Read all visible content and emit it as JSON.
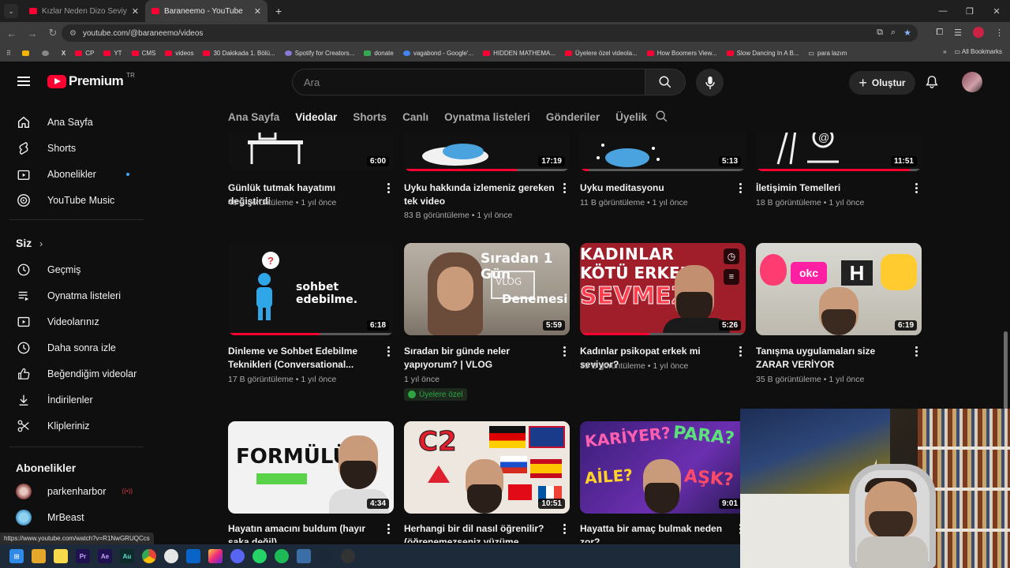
{
  "browser": {
    "tabs": [
      {
        "title": "Kızlar Neden Dizo Seviyor? - Yo",
        "active": false
      },
      {
        "title": "Baraneemo - YouTube",
        "active": true
      }
    ],
    "url": "youtube.com/@baraneemo/videos",
    "bookmarks": [
      "CP",
      "YT",
      "CMS",
      "videos",
      "30 Dakikada 1. Bölü...",
      "Spotify for Creators...",
      "donate",
      "vagabond - Google'...",
      "HIDDEN MATHEMA...",
      "Üyelere özel videola...",
      "How Boomers View...",
      "Slow Dancing In A B...",
      "para lazım"
    ],
    "all_bookmarks": "All Bookmarks",
    "status_url": "https://www.youtube.com/watch?v=R1NwGRUQCcs"
  },
  "masthead": {
    "logo_text": "Premium",
    "country": "TR",
    "search_placeholder": "Ara",
    "create_label": "Oluştur"
  },
  "sidebar": {
    "main": [
      {
        "label": "Ana Sayfa",
        "icon": "home-icon"
      },
      {
        "label": "Shorts",
        "icon": "shorts-icon"
      },
      {
        "label": "Abonelikler",
        "icon": "subscriptions-icon",
        "new": true
      },
      {
        "label": "YouTube Music",
        "icon": "music-icon"
      }
    ],
    "you_heading": "Siz",
    "you": [
      {
        "label": "Geçmiş",
        "icon": "history-icon"
      },
      {
        "label": "Oynatma listeleri",
        "icon": "playlists-icon"
      },
      {
        "label": "Videolarınız",
        "icon": "your-videos-icon"
      },
      {
        "label": "Daha sonra izle",
        "icon": "watch-later-icon"
      },
      {
        "label": "Beğendiğim videolar",
        "icon": "liked-icon"
      },
      {
        "label": "İndirilenler",
        "icon": "downloads-icon"
      },
      {
        "label": "Klipleriniz",
        "icon": "clips-icon"
      }
    ],
    "subs_heading": "Abonelikler",
    "subs": [
      {
        "label": "parkenharbor",
        "live": true
      },
      {
        "label": "MrBeast",
        "live": false
      }
    ]
  },
  "channel_tabs": [
    "Ana Sayfa",
    "Videolar",
    "Shorts",
    "Canlı",
    "Oynatma listeleri",
    "Gönderiler",
    "Üyelik"
  ],
  "active_tab": "Videolar",
  "videos": [
    {
      "title": "Günlük tutmak hayatımı değiştirdi",
      "views": "40 B görüntüleme",
      "age": "1 yıl önce",
      "duration": "6:00",
      "watched": 0
    },
    {
      "title": "Uyku hakkında izlemeniz gereken tek video",
      "views": "83 B görüntüleme",
      "age": "1 yıl önce",
      "duration": "17:19",
      "watched": 0.68
    },
    {
      "title": "Uyku meditasyonu",
      "views": "11 B görüntüleme",
      "age": "1 yıl önce",
      "duration": "5:13",
      "watched": 0.05
    },
    {
      "title": "İletişimin Temelleri",
      "views": "18 B görüntüleme",
      "age": "1 yıl önce",
      "duration": "11:51",
      "watched": 0.93
    },
    {
      "title": "Dinleme ve Sohbet Edebilme Teknikleri (Conversational...",
      "views": "17 B görüntüleme",
      "age": "1 yıl önce",
      "duration": "6:18",
      "watched": 0.55,
      "thumb_text": "sohbet edebilme."
    },
    {
      "title": "Sıradan bir günde neler yapıyorum? | VLOG",
      "views": "",
      "age": "1 yıl önce",
      "duration": "5:59",
      "watched": 0,
      "members": "Üyelere özel",
      "thumb_text": "Sıradan 1 Gün",
      "thumb_text2": "VLOG",
      "thumb_text3": "Denemesi"
    },
    {
      "title": "Kadınlar psikopat erkek mi seviyor?",
      "views": "15 B görüntüleme",
      "age": "1 yıl önce",
      "duration": "5:26",
      "watched": 0.42,
      "thumb_text": "KADINLAR",
      "thumb_text2": "KÖTÜ ERKEK",
      "thumb_text3": "SEVMEZ"
    },
    {
      "title": "Tanışma uygulamaları size ZARAR VERİYOR",
      "views": "35 B görüntüleme",
      "age": "1 yıl önce",
      "duration": "6:19",
      "watched": 0,
      "thumb_text": "okc"
    },
    {
      "title": "Hayatın amacını buldum (hayır şaka değil)",
      "views": "",
      "age": "",
      "duration": "4:34",
      "watched": 0,
      "thumb_text": "FORMÜLÜ"
    },
    {
      "title": "Herhangi bir dil nasıl öğrenilir? (öğrenemezseniz yüzüme tükürün)",
      "views": "",
      "age": "",
      "duration": "10:51",
      "watched": 0,
      "thumb_text": "C2"
    },
    {
      "title": "Hayatta bir amaç bulmak neden zor?",
      "views": "",
      "age": "",
      "duration": "9:01",
      "watched": 0,
      "thumb_text": "KARİYER?",
      "thumb_text2": "PARA?",
      "thumb_text3": "AİLE?",
      "thumb_text4": "AŞK?"
    }
  ],
  "taskbar": [
    "windows-icon",
    "explorer-icon",
    "sticky-icon",
    "Pr",
    "Ae",
    "Au",
    "chrome-icon",
    "app-icon",
    "outlook-icon",
    "instagram-icon",
    "discord-icon",
    "whatsapp-icon",
    "spotify-icon",
    "app2-icon",
    "steam-icon",
    "obs-icon"
  ]
}
